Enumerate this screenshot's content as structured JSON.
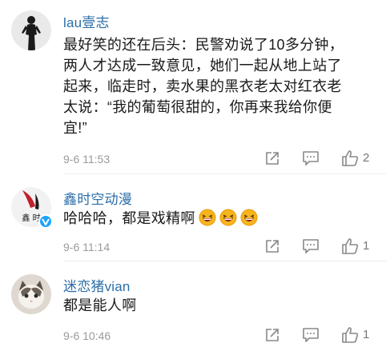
{
  "comments": [
    {
      "username": "lau壹志",
      "text_lines": [
        "最好笑的还在后头：民警劝说了10多分钟，",
        "两人才达成一致意见，她们一起从地上站了",
        "起来，临走时，卖水果的黑衣老太对红衣老",
        "太说：“我的葡萄很甜的，你再来我给你便",
        "宜!”"
      ],
      "time": "9-6 11:53",
      "likes": "2",
      "avatar_icon": "person-silhouette-avatar"
    },
    {
      "username": "鑫时空动漫",
      "text": "哈哈哈，都是戏精啊",
      "emojis": [
        "grinning-squint-emoji",
        "grinning-squint-emoji",
        "grinning-squint-emoji"
      ],
      "time": "9-6 11:14",
      "likes": "1",
      "avatar_icon": "brand-logo-avatar",
      "avatar_text": "鑫 时",
      "verified": true
    },
    {
      "username": "迷恋猪vian",
      "text": "都是能人啊",
      "time": "9-6 10:46",
      "likes": "1",
      "avatar_icon": "cat-photo-avatar"
    }
  ],
  "colors": {
    "username": "#2c6ea8",
    "meta": "#9a9a9a",
    "verified_badge": "#1aa3ff",
    "text": "#1a1a1a"
  },
  "icons": {
    "forward": "share-forward-icon",
    "reply": "comment-reply-icon",
    "like": "thumbs-up-icon"
  }
}
